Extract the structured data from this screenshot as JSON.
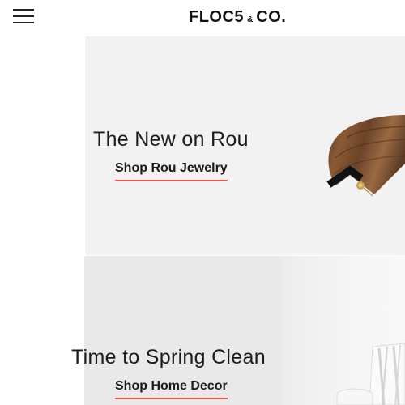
{
  "header": {
    "logo": {
      "main": "FLOC5",
      "amp": "&",
      "suffix": "CO."
    }
  },
  "heroes": [
    {
      "title": "The New on Rou",
      "link": "Shop Rou Jewelry"
    },
    {
      "title": "Time to Spring Clean",
      "link": "Shop Home Decor"
    }
  ],
  "colors": {
    "accent": "#e8544e",
    "panel_primary": "#f2f2f2",
    "panel_secondary": "#e9e9e9",
    "text": "#1c1c1c"
  }
}
